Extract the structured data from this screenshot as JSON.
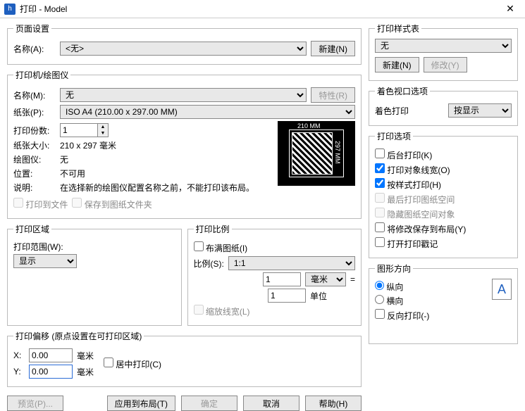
{
  "titlebar": {
    "title": "打印 - Model"
  },
  "pageSetup": {
    "legend": "页面设置",
    "nameLabel": "名称(A):",
    "nameValue": "<无>",
    "newBtn": "新建(N)"
  },
  "printer": {
    "legend": "打印机/绘图仪",
    "nameLabel": "名称(M):",
    "nameValue": "无",
    "propBtn": "特性(R)",
    "paperLabel": "纸张(P):",
    "paperValue": "ISO A4 (210.00 x 297.00 MM)",
    "copiesLabel": "打印份数:",
    "copiesValue": "1",
    "sizeLabel": "纸张大小:",
    "sizeValue": "210 x 297  毫米",
    "plotterLabel": "绘图仪:",
    "plotterValue": "无",
    "locLabel": "位置:",
    "locValue": "不可用",
    "descLabel": "说明:",
    "descValue": "在选择新的绘图仪配置名称之前，不能打印该布局。",
    "toFile": "打印到文件",
    "saveToSheet": "保存到图纸文件夹",
    "previewTop": "210 MM",
    "previewRight": "297 MM"
  },
  "area": {
    "legend": "打印区域",
    "rangeLabel": "打印范围(W):",
    "rangeValue": "显示"
  },
  "scale": {
    "legend": "打印比例",
    "fit": "布满图纸(I)",
    "ratioLabel": "比例(S):",
    "ratioValue": "1:1",
    "mmValue": "1",
    "mmUnit": "毫米",
    "eq": "=",
    "unitValue": "1",
    "unitLabel": "单位",
    "scaleLw": "缩放线宽(L)"
  },
  "offset": {
    "legend": "打印偏移 (原点设置在可打印区域)",
    "xLabel": "X:",
    "xValue": "0.00",
    "yLabel": "Y:",
    "yValue": "0.00",
    "unit": "毫米",
    "center": "居中打印(C)"
  },
  "styleTable": {
    "legend": "打印样式表",
    "value": "无",
    "newBtn": "新建(N)",
    "editBtn": "修改(Y)"
  },
  "shaded": {
    "legend": "着色视口选项",
    "label": "着色打印",
    "value": "按显示"
  },
  "options": {
    "legend": "打印选项",
    "bg": "后台打印(K)",
    "lw": "打印对象线宽(O)",
    "style": "按样式打印(H)",
    "lastPs": "最后打印图纸空间",
    "hidePs": "隐藏图纸空间对象",
    "saveLayout": "将修改保存到布局(Y)",
    "stamp": "打开打印戳记"
  },
  "orient": {
    "legend": "图形方向",
    "portrait": "纵向",
    "landscape": "横向",
    "reverse": "反向打印(-)",
    "glyph": "A"
  },
  "footer": {
    "preview": "预览(P)...",
    "apply": "应用到布局(T)",
    "ok": "确定",
    "cancel": "取消",
    "help": "帮助(H)"
  }
}
